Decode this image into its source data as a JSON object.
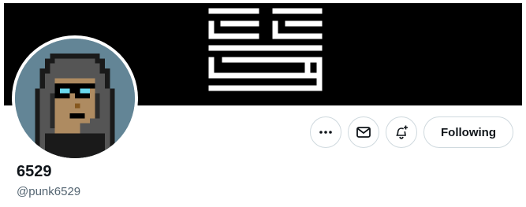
{
  "banner": {
    "background": "#000000",
    "glyph_color": "#ffffff"
  },
  "avatar": {
    "background": "#638596",
    "icon": "cryptopunk-avatar"
  },
  "actions": {
    "more_icon": "more-dots-icon",
    "message_icon": "envelope-icon",
    "notify_icon": "bell-plus-icon",
    "following_label": "Following"
  },
  "profile": {
    "display_name": "6529",
    "handle": "@punk6529"
  }
}
